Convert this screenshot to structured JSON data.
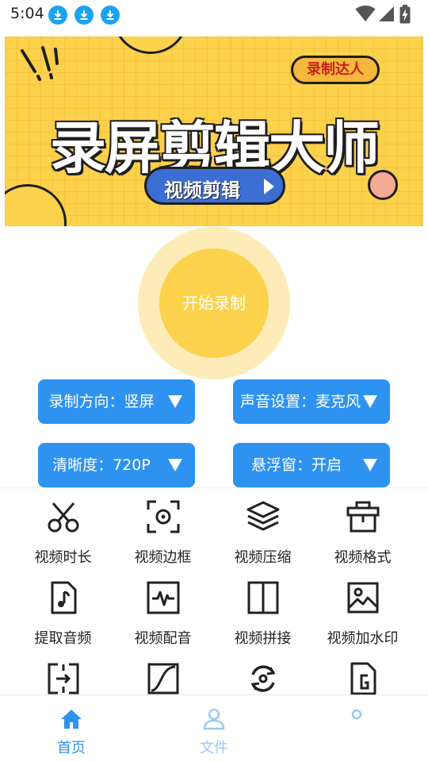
{
  "status_bar": {
    "time": "5:04",
    "download_icons": [
      "download-icon",
      "download-icon",
      "download-icon"
    ],
    "right_icons": [
      "wifi-icon",
      "signal-icon",
      "battery-charging-icon"
    ]
  },
  "banner": {
    "title": "录屏剪辑大师",
    "tag": "录制达人",
    "pill": "视频剪辑",
    "colors": {
      "background": "#fcd14b",
      "pill": "#3c6ed3",
      "tag_text": "#c4231e"
    }
  },
  "record": {
    "label": "开始录制",
    "colors": {
      "outer": "#fdecb8",
      "inner": "#fcd24d"
    }
  },
  "options": [
    {
      "label": "录制方向：竖屏"
    },
    {
      "label": "声音设置：麦克风"
    },
    {
      "label": "清晰度：720P"
    },
    {
      "label": "悬浮窗：开启"
    }
  ],
  "tools": [
    {
      "label": "视频时长",
      "icon": "scissors-icon"
    },
    {
      "label": "视频边框",
      "icon": "frame-focus-icon"
    },
    {
      "label": "视频压缩",
      "icon": "layers-icon"
    },
    {
      "label": "视频格式",
      "icon": "format-icon"
    },
    {
      "label": "提取音频",
      "icon": "audio-file-icon"
    },
    {
      "label": "视频配音",
      "icon": "waveform-icon"
    },
    {
      "label": "视频拼接",
      "icon": "split-panel-icon"
    },
    {
      "label": "视频加水印",
      "icon": "image-icon"
    },
    {
      "label": "",
      "icon": "export-icon"
    },
    {
      "label": "",
      "icon": "curve-icon"
    },
    {
      "label": "",
      "icon": "rotate-icon"
    },
    {
      "label": "",
      "icon": "gif-file-icon"
    }
  ],
  "bottom_nav": [
    {
      "label": "首页",
      "icon": "home-icon",
      "active": true
    },
    {
      "label": "文件",
      "icon": "user-icon",
      "active": false
    },
    {
      "label": "",
      "icon": "settings-icon",
      "active": false
    }
  ],
  "colors": {
    "accent": "#2e92f0",
    "nav_active": "#2e92f0",
    "nav_inactive": "#9cc8f3"
  }
}
